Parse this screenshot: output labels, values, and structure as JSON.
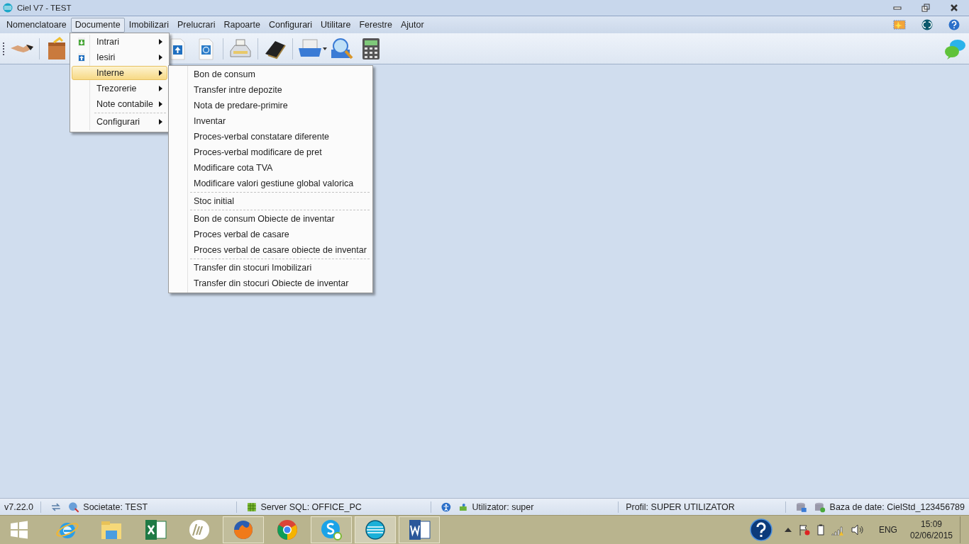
{
  "window": {
    "title": "Ciel V7 - TEST"
  },
  "menubar": [
    {
      "label": "Nomenclatoare",
      "selected": false
    },
    {
      "label": "Documente",
      "selected": true
    },
    {
      "label": "Imobilizari",
      "selected": false
    },
    {
      "label": "Prelucrari",
      "selected": false
    },
    {
      "label": "Rapoarte",
      "selected": false
    },
    {
      "label": "Configurari",
      "selected": false
    },
    {
      "label": "Utilitare",
      "selected": false
    },
    {
      "label": "Ferestre",
      "selected": false
    },
    {
      "label": "Ajutor",
      "selected": false
    }
  ],
  "toolbar": [
    {
      "kind": "handshake"
    },
    {
      "kind": "box"
    },
    {
      "kind": "upload-doc"
    },
    {
      "kind": "doc"
    },
    {
      "kind": "register"
    },
    {
      "kind": "book"
    },
    {
      "kind": "printer"
    },
    {
      "kind": "search"
    },
    {
      "kind": "calculator"
    }
  ],
  "dropdown": [
    {
      "kind": "download",
      "label": "Intrari",
      "selected": false
    },
    {
      "kind": "upload",
      "label": "Iesiri",
      "selected": false
    },
    {
      "kind": "plain",
      "label": "Interne",
      "selected": true
    },
    {
      "kind": "plain",
      "label": "Trezorerie",
      "selected": false
    },
    {
      "kind": "plain",
      "label": "Note contabile",
      "selected": false
    },
    {
      "kind": "separator"
    },
    {
      "kind": "plain",
      "label": "Configurari",
      "selected": false
    }
  ],
  "submenu": [
    {
      "kind": "item",
      "label": "Bon de consum"
    },
    {
      "kind": "item",
      "label": "Transfer intre depozite"
    },
    {
      "kind": "item",
      "label": "Nota de predare-primire"
    },
    {
      "kind": "item",
      "label": "Inventar"
    },
    {
      "kind": "item",
      "label": "Proces-verbal constatare diferente"
    },
    {
      "kind": "item",
      "label": "Proces-verbal modificare de pret"
    },
    {
      "kind": "item",
      "label": "Modificare cota TVA"
    },
    {
      "kind": "item",
      "label": "Modificare valori gestiune global valorica"
    },
    {
      "kind": "separator"
    },
    {
      "kind": "item",
      "label": "Stoc initial"
    },
    {
      "kind": "separator"
    },
    {
      "kind": "item",
      "label": "Bon de consum Obiecte de inventar"
    },
    {
      "kind": "item",
      "label": "Proces verbal de casare"
    },
    {
      "kind": "item",
      "label": "Proces verbal de casare obiecte de inventar"
    },
    {
      "kind": "separator"
    },
    {
      "kind": "item",
      "label": "Transfer din stocuri Imobilizari"
    },
    {
      "kind": "item",
      "label": "Transfer din stocuri Obiecte de inventar"
    }
  ],
  "status_bar": {
    "version": "v7.22.0",
    "company": "Societate: TEST",
    "server": "Server SQL: OFFICE_PC",
    "user": "Utilizator: super",
    "profile": "Profil: SUPER UTILIZATOR",
    "database": "Baza de date: CielStd_123456789"
  },
  "taskbar": {
    "apps": [
      {
        "kind": "ie",
        "running": false,
        "selected": false
      },
      {
        "kind": "explorer",
        "running": false,
        "selected": false
      },
      {
        "kind": "excel",
        "running": false,
        "selected": false
      },
      {
        "kind": "hp",
        "running": false,
        "selected": false
      },
      {
        "kind": "firefox",
        "running": true,
        "selected": false
      },
      {
        "kind": "chrome",
        "running": false,
        "selected": false
      },
      {
        "kind": "skype",
        "running": true,
        "selected": false
      },
      {
        "kind": "ciel",
        "running": true,
        "selected": true
      },
      {
        "kind": "word",
        "running": true,
        "selected": false
      }
    ],
    "language": "ENG",
    "time": "15:09",
    "date": "02/06/2015"
  }
}
